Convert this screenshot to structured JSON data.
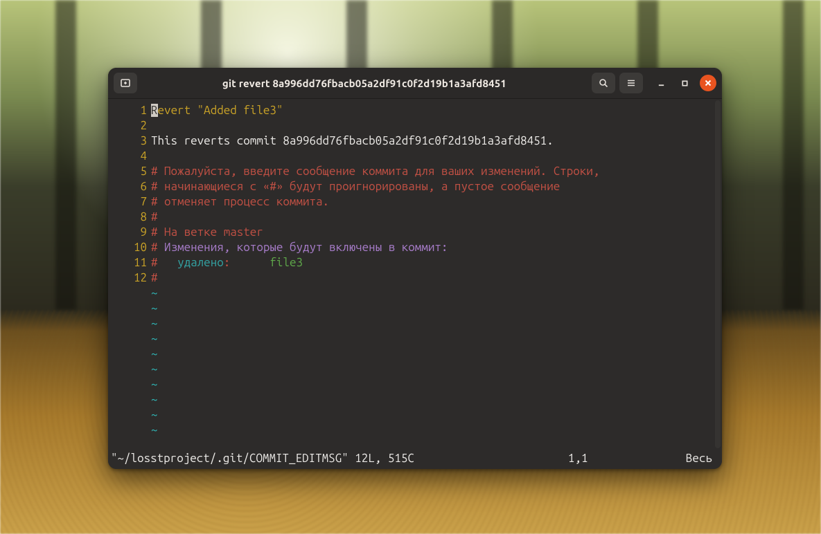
{
  "window": {
    "title": "git revert 8a996dd76fbacb05a2df91c0f2d19b1a3afd8451"
  },
  "gutter": {
    "lines": [
      "1",
      "2",
      "3",
      "4",
      "5",
      "6",
      "7",
      "8",
      "9",
      "10",
      "11",
      "12"
    ]
  },
  "content": {
    "l1_cursor": "R",
    "l1_rest": "evert \"Added file3\"",
    "l2": "",
    "l3": "This reverts commit 8a996dd76fbacb05a2df91c0f2d19b1a3afd8451.",
    "l4": "",
    "l5": "# Пожалуйста, введите сообщение коммита для ваших изменений. Строки,",
    "l6": "# начинающиеся с «#» будут проигнорированы, а пустое сообщение",
    "l7": "# отменяет процесс коммита.",
    "l8": "#",
    "l9_hash": "# ",
    "l9_rest": "На ветке master",
    "l10_hash": "#",
    "l10_rest": " Изменения, которые будут включены в коммит:",
    "l11_hash": "#",
    "l11_pad1": "   ",
    "l11_word": "удалено",
    "l11_colon": ":",
    "l11_pad2": "      ",
    "l11_file": "file3",
    "l12": "#"
  },
  "tildes": [
    "~",
    "~",
    "~",
    "~",
    "~",
    "~",
    "~",
    "~",
    "~",
    "~"
  ],
  "status": {
    "file": "\"~/losstproject/.git/COMMIT_EDITMSG\" 12L, 515C",
    "pos": "1,1",
    "pct": "Весь"
  }
}
